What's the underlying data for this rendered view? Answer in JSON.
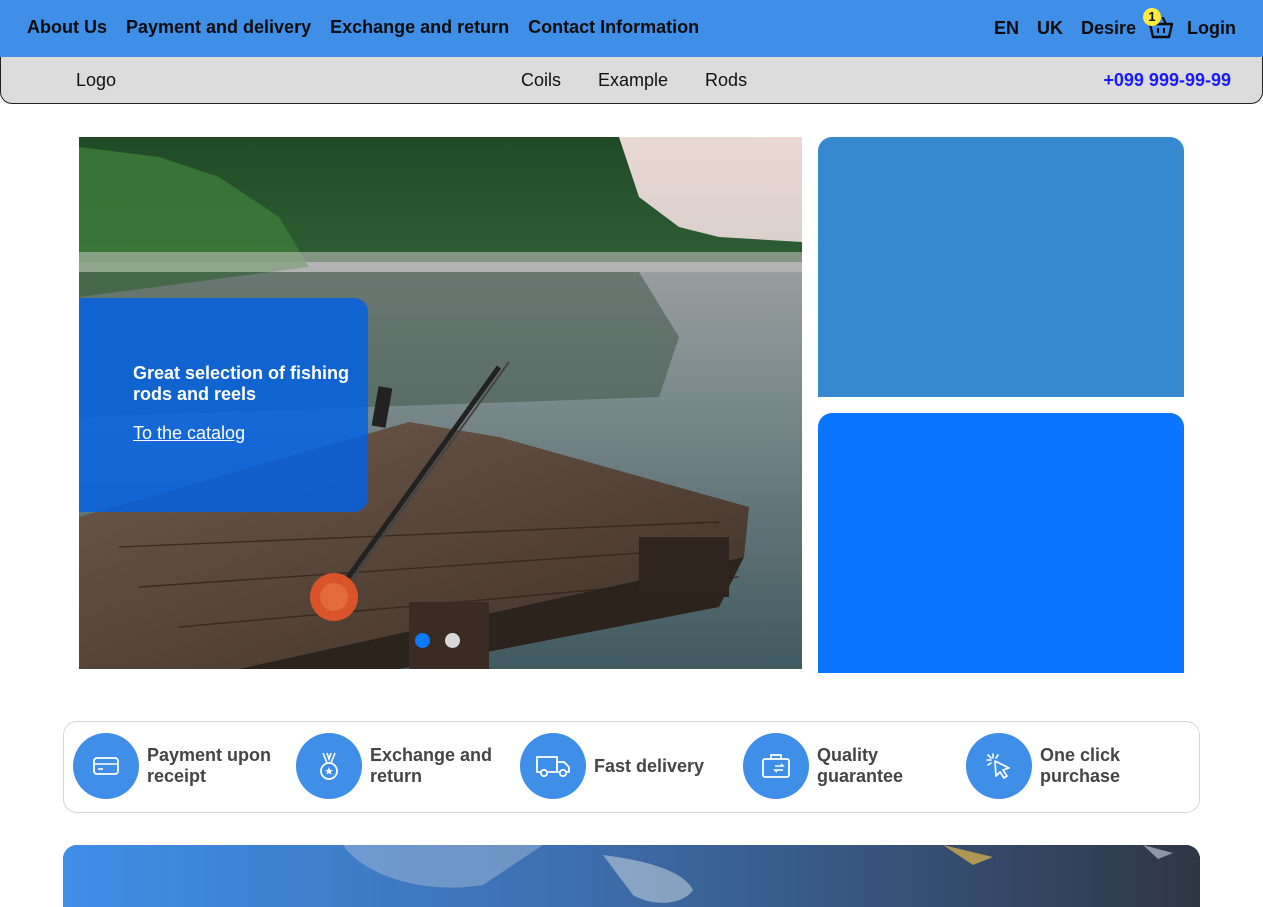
{
  "top_nav": {
    "items": [
      "About Us",
      "Payment and delivery",
      "Exchange and return",
      "Contact Information"
    ],
    "lang_en": "EN",
    "lang_uk": "UK",
    "desire": "Desire",
    "cart_count": "1",
    "login": "Login"
  },
  "sub_nav": {
    "logo": "Logo",
    "items": [
      "Coils",
      "Example",
      "Rods"
    ],
    "phone": "+099 999-99-99"
  },
  "hero": {
    "title": "Great selection of fishing rods and reels",
    "link": "To the catalog",
    "active_slide": 1,
    "slide_count": 2
  },
  "features": [
    {
      "label": "Payment upon receipt",
      "icon": "card-icon"
    },
    {
      "label": "Exchange and return",
      "icon": "medal-icon"
    },
    {
      "label": "Fast delivery",
      "icon": "truck-icon"
    },
    {
      "label": "Quality guarantee",
      "icon": "briefcase-icon"
    },
    {
      "label": "One click purchase",
      "icon": "cursor-click-icon"
    }
  ],
  "colors": {
    "top_bar": "#3f8ee8",
    "sub_bar": "#dcdcdc",
    "phone": "#1a1aff",
    "promo": "#0062e6",
    "side_card_1": "#3789cf",
    "side_card_2": "#0a75ff",
    "badge": "#ffeb3b"
  }
}
